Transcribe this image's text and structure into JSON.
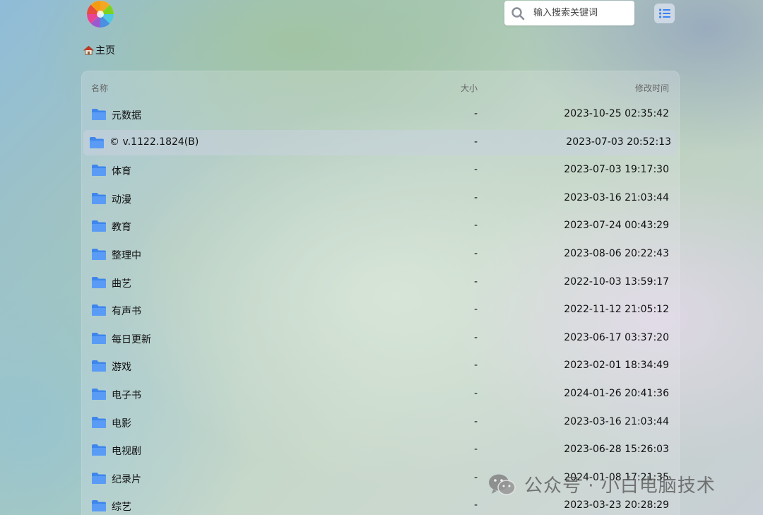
{
  "search": {
    "placeholder": "输入搜索关键词"
  },
  "breadcrumb": {
    "home_label": "主页"
  },
  "table": {
    "headers": {
      "name": "名称",
      "size": "大小",
      "modified": "修改时间"
    },
    "rows": [
      {
        "name": "元数据",
        "size": "-",
        "modified": "2023-10-25 02:35:42"
      },
      {
        "name": "© v.1122.1824(B)",
        "size": "-",
        "modified": "2023-07-03 20:52:13"
      },
      {
        "name": "体育",
        "size": "-",
        "modified": "2023-07-03 19:17:30"
      },
      {
        "name": "动漫",
        "size": "-",
        "modified": "2023-03-16 21:03:44"
      },
      {
        "name": "教育",
        "size": "-",
        "modified": "2023-07-24 00:43:29"
      },
      {
        "name": "整理中",
        "size": "-",
        "modified": "2023-08-06 20:22:43"
      },
      {
        "name": "曲艺",
        "size": "-",
        "modified": "2022-10-03 13:59:17"
      },
      {
        "name": "有声书",
        "size": "-",
        "modified": "2022-11-12 21:05:12"
      },
      {
        "name": "每日更新",
        "size": "-",
        "modified": "2023-06-17 03:37:20"
      },
      {
        "name": "游戏",
        "size": "-",
        "modified": "2023-02-01 18:34:49"
      },
      {
        "name": "电子书",
        "size": "-",
        "modified": "2024-01-26 20:41:36"
      },
      {
        "name": "电影",
        "size": "-",
        "modified": "2023-03-16 21:03:44"
      },
      {
        "name": "电视剧",
        "size": "-",
        "modified": "2023-06-28 15:26:03"
      },
      {
        "name": "纪录片",
        "size": "-",
        "modified": "2024-01-08 17:21:35"
      },
      {
        "name": "综艺",
        "size": "-",
        "modified": "2023-03-23 20:28:29"
      }
    ],
    "selected_index": 1
  },
  "watermark": {
    "text": "公众号 · 小白电脑技术"
  },
  "icons": {
    "logo": "color-wheel-logo-icon",
    "home": "house-icon",
    "search": "search-icon",
    "list_view": "list-view-icon",
    "folder": "folder-icon",
    "wechat": "wechat-icon"
  },
  "colors": {
    "folder": "#4a90f0",
    "accent": "#3b82f6",
    "selected_row": "#c8d2de"
  }
}
